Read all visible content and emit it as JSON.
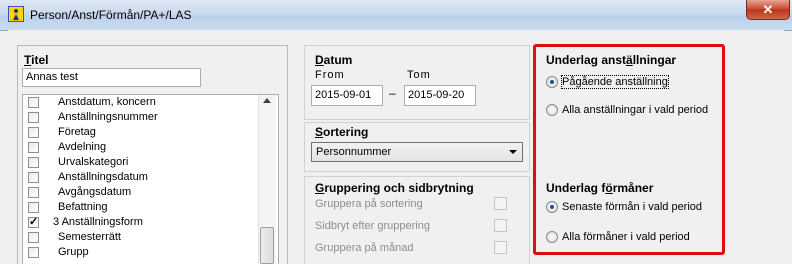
{
  "window": {
    "title": "Person/Anst/Förmån/PA+/LAS",
    "close_label": "✕"
  },
  "titel": {
    "label": "Titel",
    "value": "Annas test"
  },
  "field_list": [
    {
      "label": "Anstdatum, koncern",
      "checked": false
    },
    {
      "label": "Anställningsnummer",
      "checked": false
    },
    {
      "label": "Företag",
      "checked": false
    },
    {
      "label": "Avdelning",
      "checked": false
    },
    {
      "label": "Urvalskategori",
      "checked": false
    },
    {
      "label": "Anställningsdatum",
      "checked": false
    },
    {
      "label": "Avgångsdatum",
      "checked": false
    },
    {
      "label": "Befattning",
      "checked": false
    },
    {
      "label": "3 Anställningsform",
      "checked": true
    },
    {
      "label": "Semesterrätt",
      "checked": false
    },
    {
      "label": "Grupp",
      "checked": false
    }
  ],
  "datum": {
    "title": "Datum",
    "from_label": "From",
    "to_label": "Tom",
    "from_value": "2015-09-01",
    "to_value": "2015-09-20",
    "separator": "–"
  },
  "sortering": {
    "title": "Sortering",
    "selected": "Personnummer"
  },
  "gruppering": {
    "title": "Gruppering och sidbrytning",
    "items": [
      "Gruppera på sortering",
      "Sidbryt efter gruppering",
      "Gruppera på månad"
    ]
  },
  "underlag_anstallningar": {
    "title": "Underlag anställningar",
    "options": [
      {
        "label": "Pågående anställning",
        "selected": true
      },
      {
        "label": "Alla anställningar i vald period",
        "selected": false
      }
    ]
  },
  "underlag_formaner": {
    "title": "Underlag förmåner",
    "options": [
      {
        "label": "Senaste förmån i vald period",
        "selected": true
      },
      {
        "label": "Alla förmåner i vald period",
        "selected": false
      }
    ]
  },
  "colors": {
    "highlight_frame": "#e00d14",
    "titlebar": "#c9daee",
    "close_button": "#c7452b"
  }
}
